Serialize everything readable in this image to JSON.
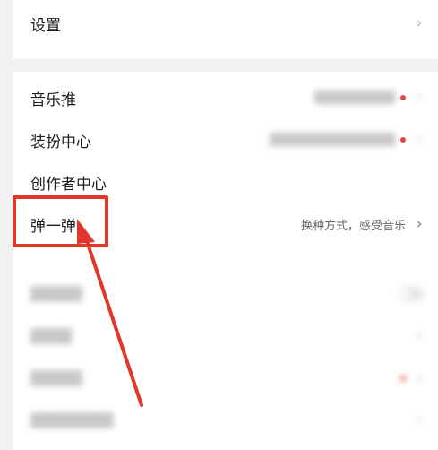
{
  "settings": {
    "label": "设置"
  },
  "menu": {
    "music_push": {
      "label": "音乐推"
    },
    "dress_center": {
      "label": "装扮中心"
    },
    "creator_center": {
      "label": "创作者中心"
    },
    "tan_yi_tan": {
      "label": "弹一弹",
      "hint": "换种方式，感受音乐"
    }
  },
  "blurred_rows": [
    {
      "label": "█████"
    },
    {
      "label": "████"
    },
    {
      "label": "█████"
    },
    {
      "label": "████████"
    }
  ],
  "icons": {
    "chevron": "chevron-right-icon",
    "arrow": "red-arrow-annotation"
  },
  "colors": {
    "highlight": "#e0362c",
    "badge": "#e8453c",
    "background": "#f2f2f2"
  }
}
